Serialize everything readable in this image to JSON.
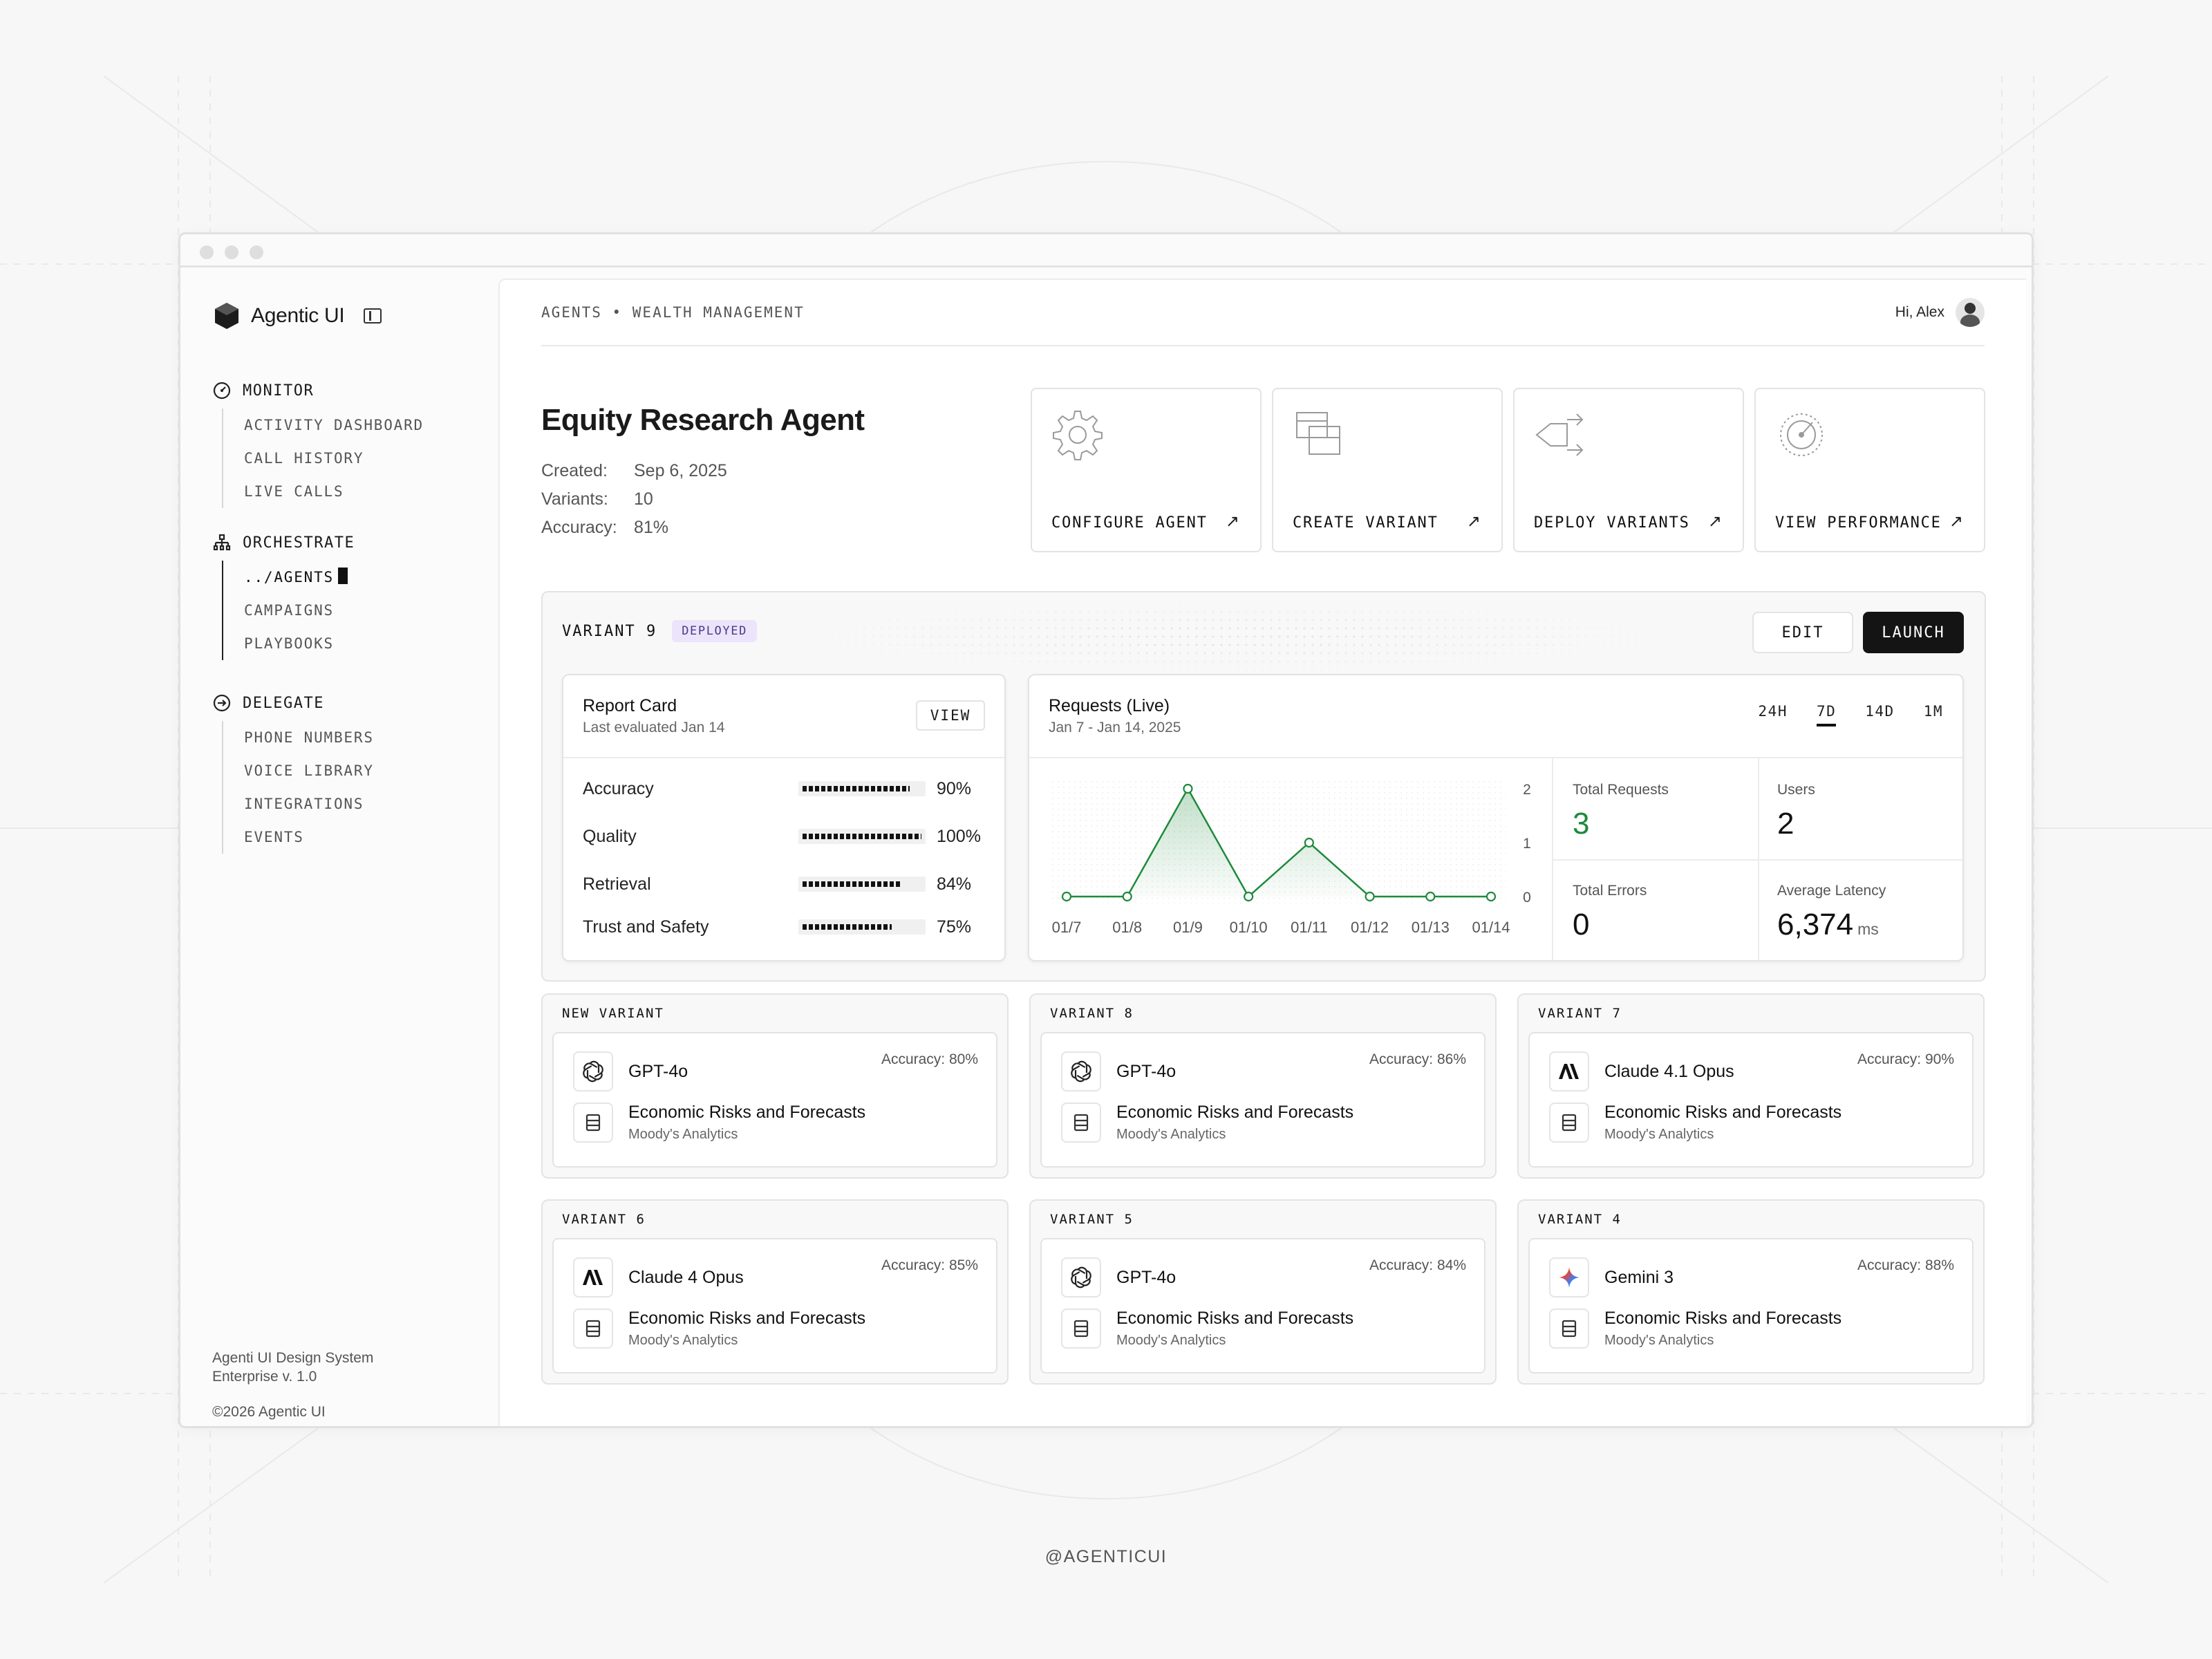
{
  "app": {
    "name": "Agentic UI"
  },
  "sidebar": {
    "groups": [
      {
        "title": "MONITOR",
        "items": [
          "ACTIVITY DASHBOARD",
          "CALL HISTORY",
          "LIVE CALLS"
        ]
      },
      {
        "title": "ORCHESTRATE",
        "items": [
          "../AGENTS",
          "CAMPAIGNS",
          "PLAYBOOKS"
        ]
      },
      {
        "title": "DELEGATE",
        "items": [
          "PHONE NUMBERS",
          "VOICE LIBRARY",
          "INTEGRATIONS",
          "EVENTS"
        ]
      }
    ],
    "footer": {
      "line1": "Agenti UI Design System",
      "line2": "Enterprise v. 1.0",
      "copyright": "©2026 Agentic UI"
    }
  },
  "header": {
    "breadcrumb": "AGENTS • WEALTH MANAGEMENT",
    "greeting": "Hi, Alex"
  },
  "agent": {
    "title": "Equity Research Agent",
    "meta": [
      {
        "label": "Created:",
        "value": "Sep 6, 2025"
      },
      {
        "label": "Variants:",
        "value": "10"
      },
      {
        "label": "Accuracy:",
        "value": "81%"
      }
    ]
  },
  "actions": [
    {
      "label": "CONFIGURE AGENT",
      "icon": "gear-icon"
    },
    {
      "label": "CREATE VARIANT",
      "icon": "create-variant-icon"
    },
    {
      "label": "DEPLOY VARIANTS",
      "icon": "deploy-icon"
    },
    {
      "label": "VIEW PERFORMANCE",
      "icon": "gauge-icon"
    }
  ],
  "variant": {
    "title": "VARIANT 9",
    "badge": "DEPLOYED",
    "edit_label": "EDIT",
    "launch_label": "LAUNCH",
    "report": {
      "title": "Report Card",
      "subtitle": "Last evaluated Jan 14",
      "view_label": "VIEW",
      "metrics": [
        {
          "name": "Accuracy",
          "value": 90,
          "label": "90%"
        },
        {
          "name": "Quality",
          "value": 100,
          "label": "100%"
        },
        {
          "name": "Retrieval",
          "value": 84,
          "label": "84%"
        },
        {
          "name": "Trust and Safety",
          "value": 75,
          "label": "75%"
        }
      ]
    },
    "requests": {
      "title": "Requests (Live)",
      "subtitle": "Jan 7 - Jan 14, 2025",
      "ranges": [
        "24H",
        "7D",
        "14D",
        "1M"
      ],
      "selected_range": "7D",
      "stats": [
        {
          "label": "Total Requests",
          "value": "3",
          "unit": "",
          "color": "#1e8a3c"
        },
        {
          "label": "Users",
          "value": "2",
          "unit": "",
          "color": "#111111"
        },
        {
          "label": "Total Errors",
          "value": "0",
          "unit": "",
          "color": "#111111"
        },
        {
          "label": "Average Latency",
          "value": "6,374",
          "unit": "ms",
          "color": "#111111"
        }
      ]
    }
  },
  "chart_data": {
    "type": "line",
    "categories": [
      "01/7",
      "01/8",
      "01/9",
      "01/10",
      "01/11",
      "01/12",
      "01/13",
      "01/14"
    ],
    "values": [
      0,
      0,
      2,
      0,
      1,
      0,
      0,
      0
    ],
    "y_ticks": [
      "0",
      "1",
      "2"
    ],
    "ylim": [
      0,
      2
    ],
    "color": "#1e8a3c",
    "grid": false
  },
  "variants": [
    {
      "title": "NEW VARIANT",
      "accuracy": "Accuracy: 80%",
      "model": "GPT-4o",
      "logo": "openai-icon",
      "dataset": "Economic Risks and Forecasts",
      "provider": "Moody's Analytics"
    },
    {
      "title": "VARIANT 8",
      "accuracy": "Accuracy: 86%",
      "model": "GPT-4o",
      "logo": "openai-icon",
      "dataset": "Economic Risks and Forecasts",
      "provider": "Moody's Analytics"
    },
    {
      "title": "VARIANT 7",
      "accuracy": "Accuracy: 90%",
      "model": "Claude 4.1 Opus",
      "logo": "anthropic-icon",
      "dataset": "Economic Risks and Forecasts",
      "provider": "Moody's Analytics"
    },
    {
      "title": "VARIANT 6",
      "accuracy": "Accuracy: 85%",
      "model": "Claude 4 Opus",
      "logo": "anthropic-icon",
      "dataset": "Economic Risks and Forecasts",
      "provider": "Moody's Analytics"
    },
    {
      "title": "VARIANT 5",
      "accuracy": "Accuracy: 84%",
      "model": "GPT-4o",
      "logo": "openai-icon",
      "dataset": "Economic Risks and Forecasts",
      "provider": "Moody's Analytics"
    },
    {
      "title": "VARIANT 4",
      "accuracy": "Accuracy: 88%",
      "model": "Gemini 3",
      "logo": "gemini-icon",
      "dataset": "Economic Risks and Forecasts",
      "provider": "Moody's Analytics"
    }
  ],
  "watermark": "@AGENTICUI"
}
